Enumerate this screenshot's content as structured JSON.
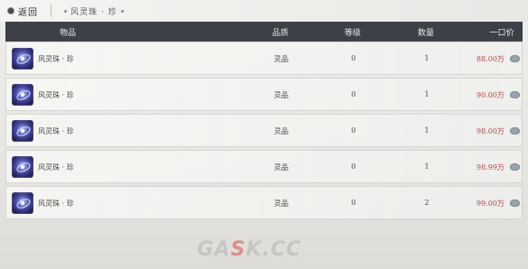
{
  "topbar": {
    "back_label": "返回",
    "breadcrumb": "风灵珠 · 珍"
  },
  "table": {
    "headers": {
      "item": "物品",
      "quality": "品质",
      "level": "等级",
      "quantity": "数量",
      "price": "一口价"
    },
    "rows": [
      {
        "name": "风灵珠 · 珍",
        "quality": "灵品",
        "level": "0",
        "quantity": "1",
        "price": "88.00万"
      },
      {
        "name": "风灵珠 · 珍",
        "quality": "灵品",
        "level": "0",
        "quantity": "1",
        "price": "90.00万"
      },
      {
        "name": "风灵珠 · 珍",
        "quality": "灵品",
        "level": "0",
        "quantity": "1",
        "price": "98.00万"
      },
      {
        "name": "风灵珠 · 珍",
        "quality": "灵品",
        "level": "0",
        "quantity": "1",
        "price": "98.99万"
      },
      {
        "name": "风灵珠 · 珍",
        "quality": "灵品",
        "level": "0",
        "quantity": "2",
        "price": "99.00万"
      }
    ],
    "item_icon": "wind-spirit-orb-icon",
    "currency_icon": "silver-ingot-icon"
  },
  "watermark": {
    "text_a": "GA",
    "text_b": "S",
    "text_c": "K.CC"
  },
  "colors": {
    "header_bg": "#3d4147",
    "price_text": "#b04a4a"
  }
}
